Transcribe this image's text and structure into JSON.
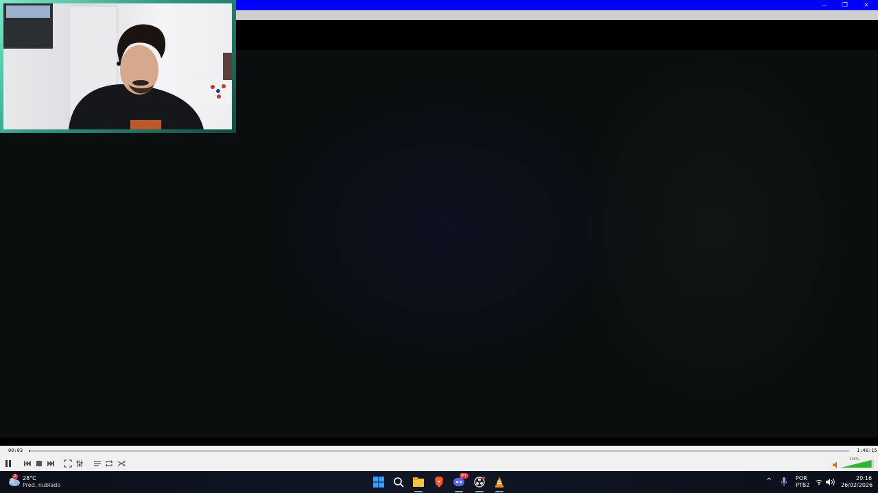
{
  "player": {
    "elapsed": "00:03",
    "duration": "1:40:15",
    "progress": 0.0005,
    "volume_label": "116%",
    "volume_level": 1.16
  },
  "window_controls": {
    "minimize": "—",
    "maximize": "❐",
    "close": "✕"
  },
  "taskbar": {
    "weather_temp": "28°C",
    "weather_desc": "Pred. nublado",
    "weather_badge": "2",
    "discord_badge": "9+",
    "language_top": "POR",
    "language_bottom": "PTB2",
    "clock_time": "20:16",
    "clock_date": "26/02/2026",
    "tray_chevron": "^",
    "pinned": [
      "start-icon",
      "search-icon",
      "file-explorer-icon",
      "brave-icon",
      "discord-icon",
      "obs-icon",
      "vlc-icon"
    ]
  },
  "colors": {
    "titlebar": "#0000ff",
    "menubar": "#cfcfcf",
    "controls_bg": "#f0f0f0",
    "webcam_border": "#5fd8b8",
    "volume_green": "#2fb52f"
  }
}
